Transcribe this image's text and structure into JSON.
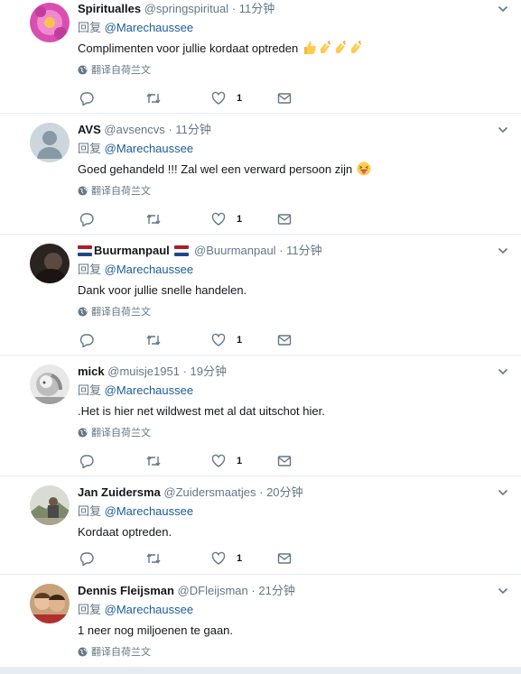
{
  "reply_prefix": "回复",
  "translate_label": "翻译自荷兰文",
  "tweets": [
    {
      "name": "Spiritualles",
      "handle": "@springspiritual",
      "time": "11分钟",
      "mention": "@Marechaussee",
      "text": "Complimenten voor jullie kordaat optreden",
      "emoji": [
        "thumbs-up",
        "clap",
        "clap",
        "clap"
      ],
      "likes": "1",
      "avatar": "pink-flower"
    },
    {
      "name": "AVS",
      "handle": "@avsencvs",
      "time": "11分钟",
      "mention": "@Marechaussee",
      "text": "Goed gehandeld !!! Zal wel een verward persoon zijn",
      "emoji": [
        "tongue-face"
      ],
      "likes": "1",
      "avatar": "default-person"
    },
    {
      "name": "Buurmanpaul",
      "handle": "@Buurmanpaul",
      "time": "11分钟",
      "mention": "@Marechaussee",
      "text": "Dank voor jullie snelle handelen.",
      "likes": "1",
      "avatar": "dark-photo",
      "flags": "netherlands"
    },
    {
      "name": "mick",
      "handle": "@muisje1951",
      "time": "19分钟",
      "mention": "@Marechaussee",
      "text": ".Het is hier net wildwest met al dat uitschot hier.",
      "likes": "1",
      "avatar": "bw-child"
    },
    {
      "name": "Jan Zuidersma",
      "handle": "@Zuidersmaatjes",
      "time": "20分钟",
      "mention": "@Marechaussee",
      "text": "Kordaat optreden.",
      "likes": "1",
      "avatar": "outdoor-photo",
      "no_translate": true
    },
    {
      "name": "Dennis Fleijsman",
      "handle": "@DFleijsman",
      "time": "21分钟",
      "mention": "@Marechaussee",
      "text": "1 neer nog miljoenen te gaan.",
      "avatar": "couple-photo"
    }
  ]
}
